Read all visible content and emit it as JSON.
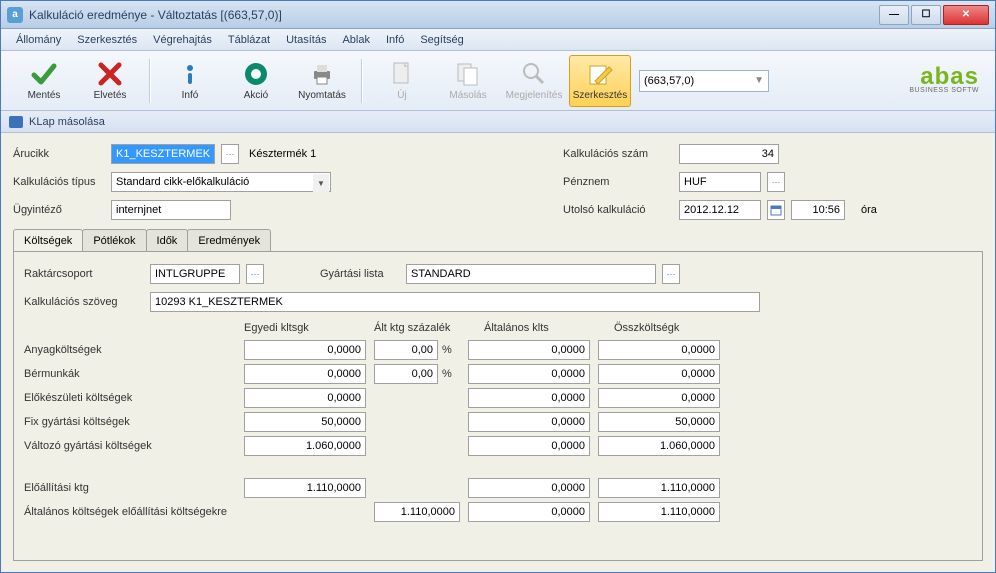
{
  "title": "Kalkuláció eredménye - Változtatás  [(663,57,0)]",
  "menu": {
    "allomany": "Állomány",
    "szerkesztes": "Szerkesztés",
    "vegrehajtas": "Végrehajtás",
    "tablazat": "Táblázat",
    "utasitas": "Utasítás",
    "ablak": "Ablak",
    "info": "Infó",
    "segitseg": "Segítség"
  },
  "toolbar": {
    "mentes": "Mentés",
    "elvetes": "Elvetés",
    "info": "Infó",
    "akcio": "Akció",
    "nyomtatas": "Nyomtatás",
    "uj": "Új",
    "masolas": "Másolás",
    "megjelenites": "Megjelenítés",
    "szerkesztes": "Szerkesztés",
    "combo_value": "(663,57,0)"
  },
  "secondary": {
    "text": "KLap másolása"
  },
  "form": {
    "arucikk_label": "Árucikk",
    "arucikk_value": "K1_KESZTERMEK",
    "arucikk_desc": "Késztermék 1",
    "kalk_tipus_label": "Kalkulációs típus",
    "kalk_tipus_value": "Standard cikk-előkalkuláció",
    "ugyintezo_label": "Ügyintéző",
    "ugyintezo_value": "internjnet",
    "kalk_szam_label": "Kalkulációs szám",
    "kalk_szam_value": "34",
    "penznem_label": "Pénznem",
    "penznem_value": "HUF",
    "utolso_kalk_label": "Utolsó kalkuláció",
    "utolso_kalk_date": "2012.12.12",
    "utolso_kalk_time": "10:56",
    "ora": "óra"
  },
  "tabs": {
    "koltsegek": "Költségek",
    "potlekok": "Pótlékok",
    "idok": "Idők",
    "eredmenyek": "Eredmények"
  },
  "tabbody": {
    "raktar_label": "Raktárcsoport",
    "raktar_value": "INTLGRUPPE",
    "gyartasi_label": "Gyártási lista",
    "gyartasi_value": "STANDARD",
    "kalk_szoveg_label": "Kalkulációs szöveg",
    "kalk_szoveg_value": "10293 K1_KESZTERMEK"
  },
  "costs": {
    "headers": {
      "egyedi": "Egyedi kltsgk",
      "alt_pct": "Ált ktg százalék",
      "altalanos": "Általános klts",
      "ossz": "Összköltségk"
    },
    "rows": [
      {
        "label": "Anyagköltségek",
        "egyedi": "0,0000",
        "pct": "0,00",
        "alt": "0,0000",
        "ossz": "0,0000"
      },
      {
        "label": "Bérmunkák",
        "egyedi": "0,0000",
        "pct": "0,00",
        "alt": "0,0000",
        "ossz": "0,0000"
      },
      {
        "label": "Előkészületi költségek",
        "egyedi": "0,0000",
        "pct": "",
        "alt": "0,0000",
        "ossz": "0,0000"
      },
      {
        "label": "Fix gyártási költségek",
        "egyedi": "50,0000",
        "pct": "",
        "alt": "0,0000",
        "ossz": "50,0000"
      },
      {
        "label": "Változó gyártási költségek",
        "egyedi": "1.060,0000",
        "pct": "",
        "alt": "0,0000",
        "ossz": "1.060,0000"
      }
    ],
    "summary1": {
      "label": "Előállítási ktg",
      "egyedi": "1.110,0000",
      "alt": "0,0000",
      "ossz": "1.110,0000"
    },
    "summary2": {
      "label": "Általános költségek előállítási költségekre",
      "pctval": "1.110,0000",
      "alt": "0,0000",
      "ossz": "1.110,0000"
    }
  },
  "logo": {
    "name": "abas",
    "sub": "BUSINESS SOFTW"
  }
}
